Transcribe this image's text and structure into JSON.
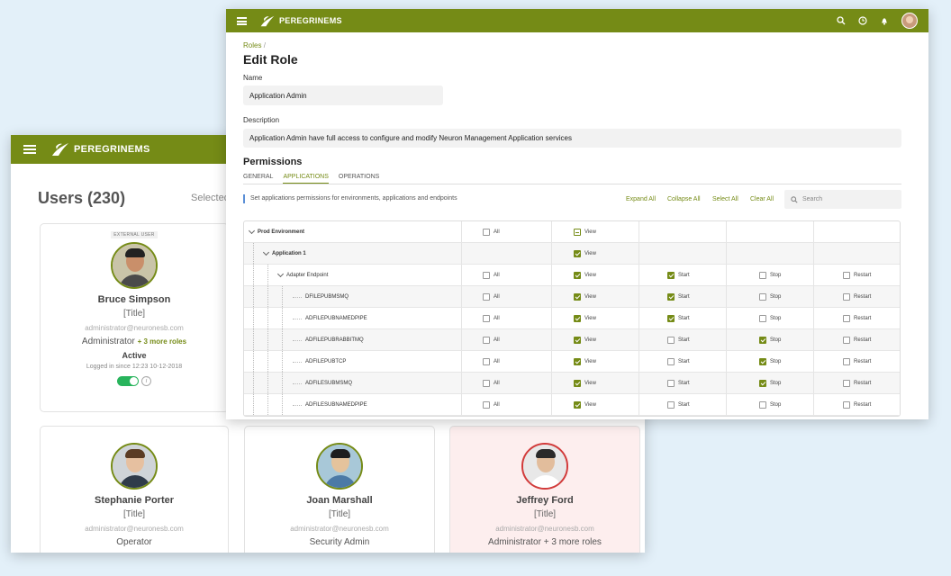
{
  "brand": {
    "name": "PEREGRINEMS",
    "color": "#758b16"
  },
  "back_window": {
    "title": "Users (230)",
    "selected_label": "Selected",
    "cards": [
      {
        "badge": "EXTERNAL USER",
        "name": "Bruce Simpson",
        "title": "[Title]",
        "email": "administrator@neuronesb.com",
        "role": "Administrator",
        "more_roles": "+ 3 more roles",
        "status": "Active",
        "logged": "Logged in since 12:23 10-12-2018",
        "info": "i"
      },
      {
        "name": "Stephanie Porter",
        "title": "[Title]",
        "email": "administrator@neuronesb.com",
        "role": "Operator"
      },
      {
        "name": "Joan Marshall",
        "title": "[Title]",
        "email": "administrator@neuronesb.com",
        "role": "Security Admin"
      },
      {
        "name": "Jeffrey Ford",
        "title": "[Title]",
        "email": "administrator@neuronesb.com",
        "role": "Administrator + 3 more roles"
      }
    ]
  },
  "front_window": {
    "icons": [
      "menu-icon",
      "search-icon",
      "clock-icon",
      "bell-icon",
      "avatar"
    ],
    "breadcrumb": {
      "link": "Roles",
      "sep": "/"
    },
    "title": "Edit Role",
    "name_label": "Name",
    "name_value": "Application Admin",
    "desc_label": "Description",
    "desc_value": "Application Admin have full access to configure and modify Neuron Management Application services",
    "permissions_title": "Permissions",
    "tabs": [
      "GENERAL",
      "APPLICATIONS",
      "OPERATIONS"
    ],
    "active_tab": "APPLICATIONS",
    "hint": "Set applications permissions for environments, applications and endpoints",
    "actions": [
      "Expand All",
      "Collapse All",
      "Select All",
      "Clear All"
    ],
    "search_placeholder": "Search",
    "grid": {
      "labels": {
        "all": "All",
        "view": "View",
        "start": "Start",
        "stop": "Stop",
        "restart": "Restart"
      },
      "rows": [
        {
          "name": "Prod Environment",
          "level": 0,
          "bold": true,
          "chevron": true,
          "all": "off",
          "view": "partial"
        },
        {
          "name": "Application 1",
          "level": 1,
          "bold": true,
          "chevron": true,
          "view": "on"
        },
        {
          "name": "Adapter Endpoint",
          "level": 2,
          "bold": false,
          "chevron": true,
          "all": "off",
          "view": "on",
          "start": "on",
          "stop": "off",
          "restart": "off"
        },
        {
          "name": "DFILEPUBMSMQ",
          "level": 3,
          "all": "off",
          "view": "on",
          "start": "on",
          "stop": "off",
          "restart": "off"
        },
        {
          "name": "ADFILEPUBNAMEDPIPE",
          "level": 3,
          "all": "off",
          "view": "on",
          "start": "on",
          "stop": "off",
          "restart": "off"
        },
        {
          "name": "ADFILEPUBRABBITMQ",
          "level": 3,
          "all": "off",
          "view": "on",
          "start": "off",
          "stop": "on",
          "restart": "off"
        },
        {
          "name": "ADFILEPUBTCP",
          "level": 3,
          "all": "off",
          "view": "on",
          "start": "off",
          "stop": "on",
          "restart": "off"
        },
        {
          "name": "ADFILESUBMSMQ",
          "level": 3,
          "all": "off",
          "view": "on",
          "start": "off",
          "stop": "on",
          "restart": "off"
        },
        {
          "name": "ADFILESUBNAMEDPIPE",
          "level": 3,
          "all": "off",
          "view": "on",
          "start": "off",
          "stop": "off",
          "restart": "off"
        }
      ]
    }
  }
}
